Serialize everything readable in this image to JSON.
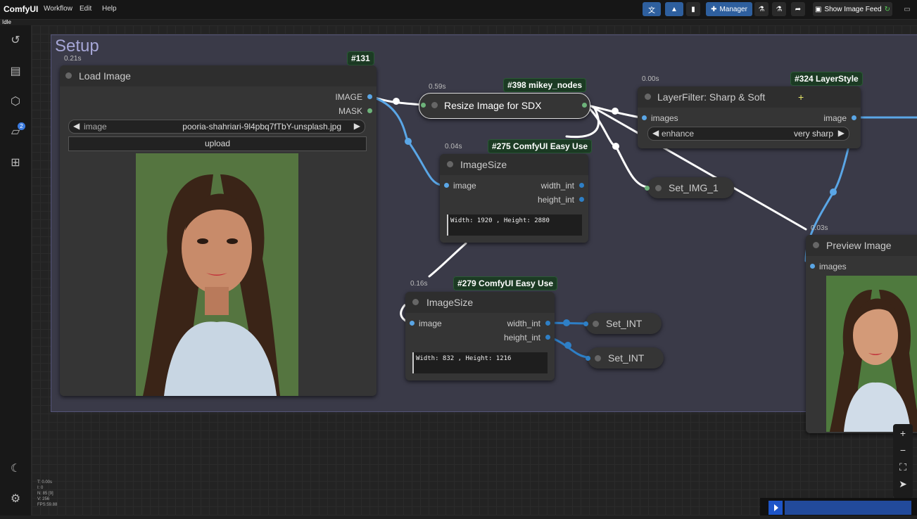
{
  "app": {
    "brand": "ComfyUI",
    "status": "Idle"
  },
  "menu": {
    "workflow": "Workflow",
    "edit": "Edit",
    "help": "Help"
  },
  "toolbar": {
    "manager_label": "Manager",
    "show_image_feed_label": "Show Image Feed"
  },
  "sidebar": {
    "queue_badge": "2",
    "icons": [
      "history-icon",
      "document-icon",
      "cube-icon",
      "folder-icon",
      "sitemap-icon",
      "moon-icon",
      "gear-icon"
    ]
  },
  "group": {
    "title": "Setup"
  },
  "nodes": {
    "load_image": {
      "id": "#131",
      "time": "0.21s",
      "title": "Load Image",
      "out_image": "IMAGE",
      "out_mask": "MASK",
      "widget_label": "image",
      "widget_value": "pooria-shahriari-9l4pbq7fTbY-unsplash.jpg",
      "upload_label": "upload"
    },
    "resize": {
      "id": "#398 mikey_nodes",
      "time": "0.59s",
      "title": "Resize Image for SDX"
    },
    "layerfilter": {
      "id": "#324 LayerStyle",
      "time": "0.00s",
      "title": "LayerFilter: Sharp & Soft",
      "in_images": "images",
      "out_image": "image",
      "widget_label": "enhance",
      "widget_value": "very sharp"
    },
    "imagesize_a": {
      "id": "#275 ComfyUI Easy Use",
      "time": "0.04s",
      "title": "ImageSize",
      "in_image": "image",
      "out_width": "width_int",
      "out_height": "height_int",
      "display": "Width: 1920 , Height: 2880"
    },
    "set_img": {
      "title": "Set_IMG_1"
    },
    "imagesize_b": {
      "id": "#279 ComfyUI Easy Use",
      "time": "0.16s",
      "title": "ImageSize",
      "in_image": "image",
      "out_width": "width_int",
      "out_height": "height_int",
      "display": "Width: 832 , Height: 1216"
    },
    "set_int_1": {
      "title": "Set_INT"
    },
    "set_int_2": {
      "title": "Set_INT"
    },
    "preview": {
      "time": "0.03s",
      "title": "Preview Image",
      "in_images": "images"
    }
  },
  "stats": {
    "t": "T: 0.00s",
    "i": "I: 0",
    "n": "N: 85 [9]",
    "v": "V: 256",
    "fps": "FPS:59.88"
  },
  "colors": {
    "accent": "#2e5f9e",
    "badge": "#1c3b24",
    "link_image": "#5aa6e6",
    "link_white": "#ffffff",
    "group": "#3a3a48"
  }
}
